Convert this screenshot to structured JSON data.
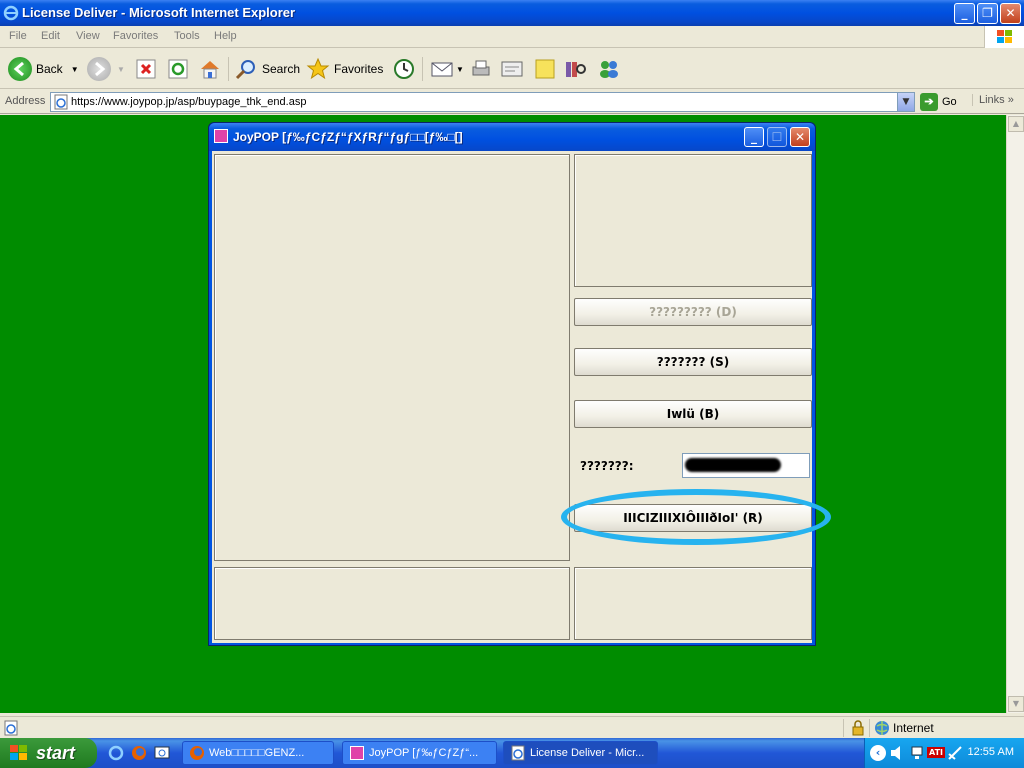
{
  "ie": {
    "title": "License Deliver - Microsoft Internet Explorer",
    "menu": [
      "File",
      "Edit",
      "View",
      "Favorites",
      "Tools",
      "Help"
    ],
    "toolbar": {
      "back": "Back",
      "search": "Search",
      "favorites": "Favorites"
    },
    "address_label": "Address",
    "address_url": "https://www.joypop.jp/asp/buypage_thk_end.asp",
    "go": "Go",
    "links": "Links",
    "status_zone": "Internet",
    "page_bg_color": "#008c00"
  },
  "dialog": {
    "title": "JoyPOP [ƒ‰ƒCƒZƒ“ƒXƒRƒ“ƒgƒ□□[ƒ‰□[]",
    "buttons": {
      "disabled_btn": "????????? (D)",
      "s_btn": "??????? (S)",
      "b_btn": "Iwlü (B)",
      "r_btn": "IIICIZIIIXIÔIIIðIoI' (R)"
    },
    "field_label": "???????:",
    "highlight_color": "#27b3ef"
  },
  "taskbar": {
    "start": "start",
    "tasks": [
      {
        "label": "Web□□□□□GENZ..."
      },
      {
        "label": "JoyPOP [ƒ‰ƒCƒZƒ“..."
      },
      {
        "label": "License Deliver - Micr..."
      }
    ],
    "clock": "12:55 AM"
  }
}
